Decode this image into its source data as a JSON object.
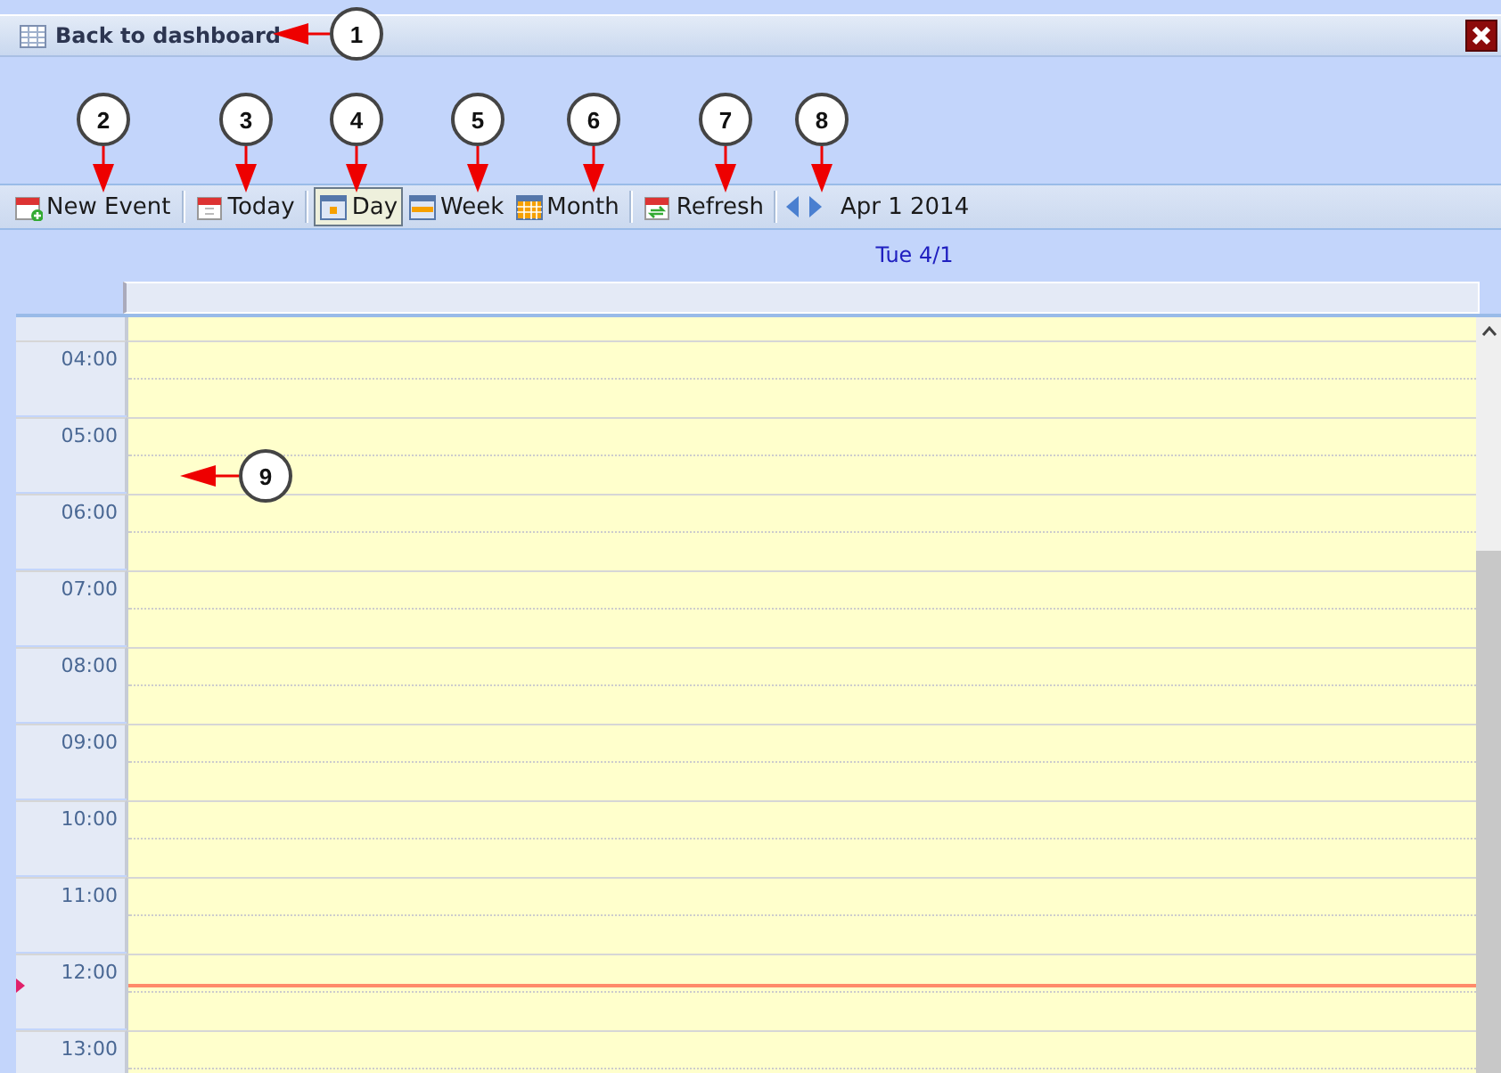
{
  "title_bar": {
    "title": "Back to dashboard"
  },
  "toolbar": {
    "groups": [
      [
        {
          "label": "New Event",
          "selected": false
        }
      ],
      [
        {
          "label": "Today",
          "selected": false
        }
      ],
      [
        {
          "label": "Day",
          "selected": true
        },
        {
          "label": "Week",
          "selected": false
        },
        {
          "label": "Month",
          "selected": false
        }
      ],
      [
        {
          "label": "Refresh",
          "selected": false
        }
      ]
    ],
    "date": "Apr 1 2014"
  },
  "day_header": {
    "label": "Tue 4/1"
  },
  "hours": [
    "04:00",
    "05:00",
    "06:00",
    "07:00",
    "08:00",
    "09:00",
    "10:00",
    "11:00",
    "12:00",
    "13:00"
  ],
  "callouts": [
    "1",
    "2",
    "3",
    "4",
    "5",
    "6",
    "7",
    "8",
    "9"
  ]
}
